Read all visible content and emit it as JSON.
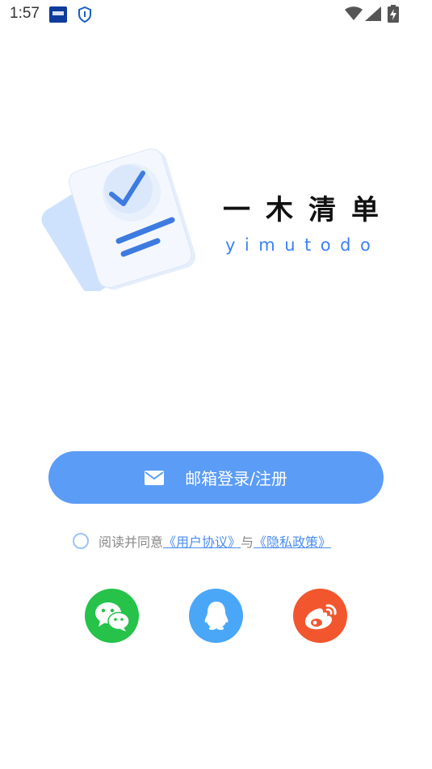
{
  "status_bar": {
    "time": "1:57"
  },
  "app": {
    "title": "一木清单",
    "subtitle": "yimutodo"
  },
  "login": {
    "button_label": "邮箱登录/注册",
    "icon": "mail-icon"
  },
  "agreement": {
    "prefix": "阅读并同意",
    "user_agreement": "《用户协议》",
    "connector": "与",
    "privacy_policy": "《隐私政策》",
    "checked": false
  },
  "social_login": [
    {
      "name": "wechat",
      "icon": "wechat-icon",
      "color": "#26c24a"
    },
    {
      "name": "qq",
      "icon": "qq-icon",
      "color": "#4aa7f7"
    },
    {
      "name": "weibo",
      "icon": "weibo-icon",
      "color": "#f2562e"
    }
  ],
  "colors": {
    "primary": "#5b9cf6",
    "link": "#4a8cf0",
    "muted_text": "#888888"
  }
}
